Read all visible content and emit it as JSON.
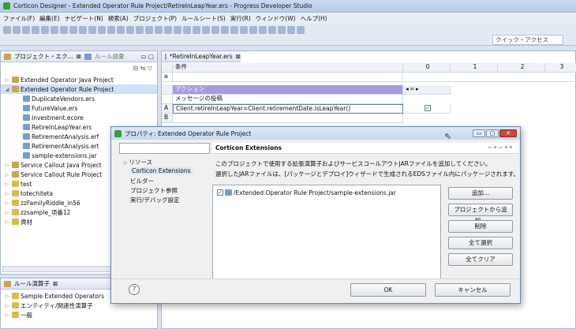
{
  "window": {
    "title": "Corticon Designer - Extended Operator Rule Project/RetireInLeapYear.ers - Progress Developer Studio"
  },
  "menu": [
    "ファイル(F)",
    "編集(E)",
    "ナビゲート(N)",
    "検索(A)",
    "プロジェクト(P)",
    "ルールシート(S)",
    "実行(R)",
    "ウィンドウ(W)",
    "ヘルプ(H)"
  ],
  "toolbar": {
    "quick_access": "クイック・アクセス"
  },
  "project_explorer": {
    "tab1": "プロジェクト・エク...",
    "tab2": "ルール語彙",
    "items": [
      {
        "label": "Extended Operator Java Project",
        "kind": "project",
        "indent": 0,
        "expand": "▷"
      },
      {
        "label": "Extended Operator Rule Project",
        "kind": "project",
        "indent": 0,
        "expand": "◢"
      },
      {
        "label": "DuplicateVendors.ers",
        "kind": "file",
        "indent": 1,
        "expand": ""
      },
      {
        "label": "FutureValue.ers",
        "kind": "file",
        "indent": 1,
        "expand": ""
      },
      {
        "label": "Investment.ecore",
        "kind": "file",
        "indent": 1,
        "expand": ""
      },
      {
        "label": "RetireInLeapYear.ers",
        "kind": "file",
        "indent": 1,
        "expand": ""
      },
      {
        "label": "RetirementAnalysis.erf",
        "kind": "file",
        "indent": 1,
        "expand": ""
      },
      {
        "label": "RetirementAnalysis.ert",
        "kind": "file",
        "indent": 1,
        "expand": ""
      },
      {
        "label": "sample-extensions.jar",
        "kind": "file",
        "indent": 1,
        "expand": ""
      },
      {
        "label": "Service Callout Java Project",
        "kind": "project",
        "indent": 0,
        "expand": "▷"
      },
      {
        "label": "Service Callout Rule Project",
        "kind": "project",
        "indent": 0,
        "expand": "▷"
      },
      {
        "label": "test",
        "kind": "folder",
        "indent": 0,
        "expand": "▷"
      },
      {
        "label": "totechiteta",
        "kind": "folder",
        "indent": 0,
        "expand": "▷"
      },
      {
        "label": "zzFamilyRiddle_in56",
        "kind": "folder",
        "indent": 0,
        "expand": "▷"
      },
      {
        "label": "zzsample_项番12",
        "kind": "folder",
        "indent": 0,
        "expand": "▷"
      },
      {
        "label": "資材",
        "kind": "folder",
        "indent": 0,
        "expand": "▷"
      }
    ]
  },
  "vocab_panel": {
    "tab": "ルール演算子",
    "items": [
      "Sample Extended Operators",
      "エンティティ/関連性演算子",
      "一般"
    ]
  },
  "editor": {
    "tab": "*RetireInLeapYear.ers",
    "condition_header": "条件",
    "columns": [
      "0",
      "1",
      "2",
      "3"
    ],
    "row_a": "a",
    "action_header": "アクション",
    "message_row": "メッセージの投稿",
    "row_label_a": "A",
    "action_expr": "Client.retireInLeapYear=Client.retirementDate.isLeapYear()",
    "row_label_b": "B",
    "action_check": "✓"
  },
  "dialog": {
    "title": "プロパティ: Extended Operator Rule Project",
    "nav": [
      "リソース",
      "Corticon Extensions",
      "ビルダー",
      "プロジェクト参照",
      "実行/デバッグ設定"
    ],
    "selected_nav": "Corticon Extensions",
    "panel_title": "Corticon Extensions",
    "desc1": "このプロジェクトで使用する拡張演算子およびサービスコールアウトJARファイルを追加してください。",
    "desc2": "選択したJARファイルは、[パッケージとデプロイ]ウィザードで生成されるEDSファイル内にパッケージされます。",
    "jar_path": "/Extended Operator Rule Project/sample-extensions.jar",
    "buttons": [
      "追加...",
      "プロジェクトから追加...",
      "削除",
      "全て選択",
      "全てクリア"
    ],
    "ok": "OK",
    "cancel": "キャンセル"
  }
}
